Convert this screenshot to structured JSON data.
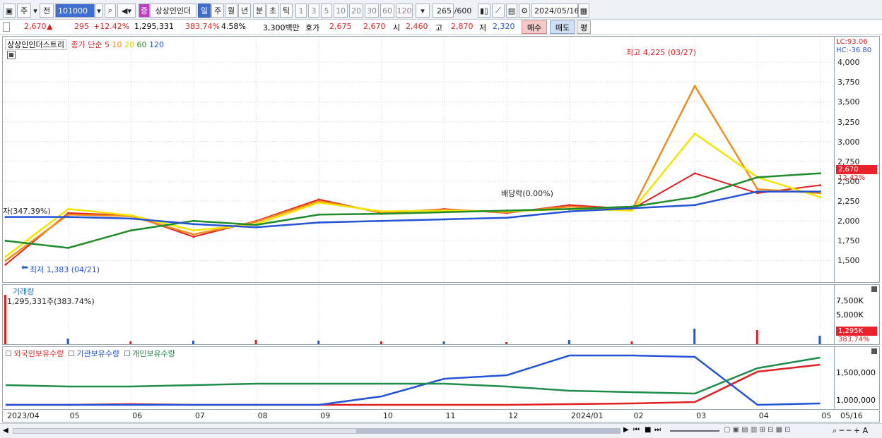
{
  "toolbar": {
    "market_mode": "주",
    "prev_label": "전",
    "stock_code": "101000",
    "stock_badge": "증",
    "stock_name": "상상인인더",
    "periods": [
      "일",
      "주",
      "월",
      "년",
      "분",
      "초",
      "틱"
    ],
    "selected_period": "일",
    "intervals": [
      "1",
      "3",
      "5",
      "10",
      "20",
      "30",
      "60",
      "120"
    ],
    "data_count": "265",
    "data_max": "/600",
    "date": "2024/05/16"
  },
  "quote": {
    "price": "2,670",
    "change": "295",
    "change_pct": "+12.42%",
    "volume": "1,295,331",
    "volume_ratio": "383.74%",
    "turnover": "4.58%",
    "amount": "3,300백만",
    "bid_label": "호가",
    "ask_price": "2,675",
    "bid_price": "2,670",
    "open_label": "시",
    "open": "2,460",
    "high_label": "고",
    "high": "2,870",
    "low_label": "저",
    "low": "2,320",
    "buy_btn": "매수",
    "sell_btn": "매도",
    "avg_btn": "평"
  },
  "price_pane": {
    "title": "상상인인더스트리",
    "legend_prefix": "종가 단순",
    "ma": [
      {
        "label": "5",
        "color": "#e02020"
      },
      {
        "label": "10",
        "color": "#f08c1a"
      },
      {
        "label": "20",
        "color": "#f2e400"
      },
      {
        "label": "60",
        "color": "#1e8c2a"
      },
      {
        "label": "120",
        "color": "#2453d6"
      }
    ],
    "lc": "LC:93.06",
    "hc": "HC:-36.80",
    "high_note": "최고 4,225 (03/27)",
    "low_note": "최저 1,383 (04/21)",
    "dividend_note": "배당락(0.00%)",
    "left_note": "자(347.39%)",
    "y_ticks": [
      "4,000",
      "3,750",
      "3,500",
      "3,250",
      "3,000",
      "2,750",
      "2,500",
      "2,250",
      "2,000",
      "1,750",
      "1,500"
    ],
    "last_price_tag": "2,670",
    "last_pct_tag": "12.42%"
  },
  "volume_pane": {
    "title": "거래량",
    "value_label": "1,295,331주(383.74%)",
    "y_ticks": [
      "7,500K",
      "5,000K"
    ],
    "last_tag": "1,295K",
    "last_pct": "383.74%"
  },
  "holdings_pane": {
    "series": [
      {
        "name": "외국인보유수량",
        "color": "#e02020"
      },
      {
        "name": "기관보유수량",
        "color": "#2453d6"
      },
      {
        "name": "개인보유수량",
        "color": "#1e8c4a"
      }
    ],
    "y_ticks": [
      "1,500,000",
      "1,000,000"
    ]
  },
  "x_axis": {
    "labels": [
      "2023/04",
      "05",
      "06",
      "07",
      "08",
      "09",
      "10",
      "11",
      "12",
      "2024/01",
      "02",
      "03",
      "04",
      "05"
    ],
    "end_label": "05/16"
  },
  "chart_data": {
    "type": "line",
    "x": [
      "2023/04",
      "05",
      "06",
      "07",
      "08",
      "09",
      "10",
      "11",
      "12",
      "2024/01",
      "02",
      "03",
      "04",
      "05"
    ],
    "series": [
      {
        "name": "5",
        "values": [
          1450,
          2100,
          2070,
          1800,
          2000,
          2270,
          2100,
          2150,
          2100,
          2200,
          2150,
          2600,
          2350,
          2450
        ]
      },
      {
        "name": "10",
        "values": [
          1500,
          2080,
          2060,
          1830,
          1990,
          2250,
          2110,
          2140,
          2110,
          2180,
          2140,
          3700,
          2400,
          2350
        ]
      },
      {
        "name": "20",
        "values": [
          1550,
          2150,
          2070,
          1880,
          1960,
          2230,
          2120,
          2130,
          2120,
          2150,
          2130,
          3100,
          2550,
          2300
        ]
      },
      {
        "name": "60",
        "values": [
          1750,
          1660,
          1880,
          2000,
          1950,
          2080,
          2090,
          2110,
          2130,
          2150,
          2180,
          2300,
          2550,
          2600
        ]
      },
      {
        "name": "120",
        "values": [
          2050,
          2050,
          2030,
          1960,
          1920,
          1980,
          2000,
          2020,
          2040,
          2120,
          2160,
          2200,
          2370,
          2370
        ]
      }
    ],
    "ylim": [
      1300,
      4250
    ]
  }
}
